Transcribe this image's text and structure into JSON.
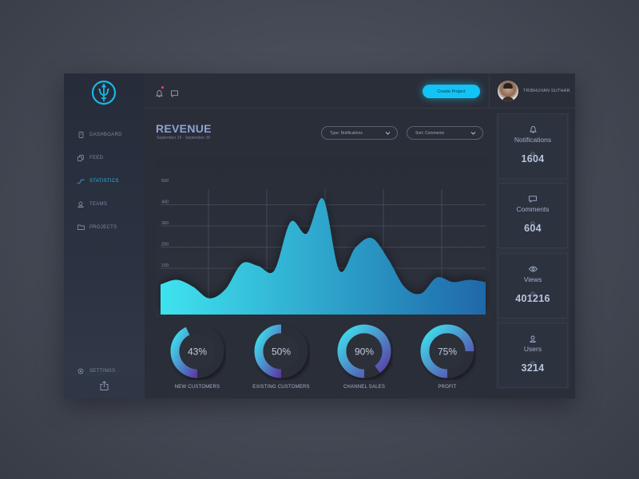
{
  "app": {
    "logo": "trident-logo",
    "accent_color": "#12c4f5"
  },
  "sidebar": {
    "items": [
      {
        "label": "DASHBOARD",
        "icon": "dashboard-icon",
        "active": false
      },
      {
        "label": "FEED",
        "icon": "feed-icon",
        "active": false
      },
      {
        "label": "STATISTICS",
        "icon": "statistics-icon",
        "active": true
      },
      {
        "label": "TEAMS",
        "icon": "teams-icon",
        "active": false
      },
      {
        "label": "PROJECTS",
        "icon": "folder-icon",
        "active": false
      }
    ],
    "settings_label": "SETTINGS",
    "export_icon": "share-icon"
  },
  "topbar": {
    "notification_badge": true,
    "create_button": "Create Project",
    "user_name": "TRIBHUVAN SUTHAR"
  },
  "revenue": {
    "title": "REVENUE",
    "date_range": "September 15 - September 30",
    "filter_type": "Type: Notifications",
    "filter_sort": "Sort: Comments"
  },
  "stats": [
    {
      "label": "Notifications",
      "value": "1604",
      "icon": "bell-icon"
    },
    {
      "label": "Comments",
      "value": "604",
      "icon": "comment-icon"
    },
    {
      "label": "Views",
      "value": "401216",
      "icon": "eye-icon"
    },
    {
      "label": "Users",
      "value": "3214",
      "icon": "user-icon"
    }
  ],
  "chart_data": [
    {
      "type": "area",
      "title": "Revenue",
      "y_ticks": [
        "100",
        "200",
        "300",
        "400",
        "500"
      ],
      "ylim": [
        0,
        500
      ],
      "grid": true,
      "x": [
        0,
        1,
        2,
        3,
        4,
        5,
        6,
        7,
        8,
        9,
        10,
        11,
        12,
        13,
        14,
        15,
        16,
        17,
        18,
        19,
        20
      ],
      "values": [
        65,
        75,
        60,
        35,
        55,
        110,
        105,
        95,
        200,
        175,
        250,
        95,
        145,
        165,
        120,
        60,
        45,
        80,
        70,
        75,
        70
      ],
      "gradient": [
        "#3ee3ef",
        "#1f68a9"
      ]
    },
    {
      "type": "pie",
      "title": "KPI rings",
      "series": [
        {
          "name": "NEW CUSTOMERS",
          "value": 43,
          "label": "43%"
        },
        {
          "name": "EXISTING CUSTOMERS",
          "value": 50,
          "label": "50%"
        },
        {
          "name": "CHANNEL SALES",
          "value": 90,
          "label": "90%"
        },
        {
          "name": "PROFIT",
          "value": 75,
          "label": "75%"
        }
      ],
      "gradient": [
        "#3ee3ef",
        "#5b3aa5"
      ]
    }
  ]
}
